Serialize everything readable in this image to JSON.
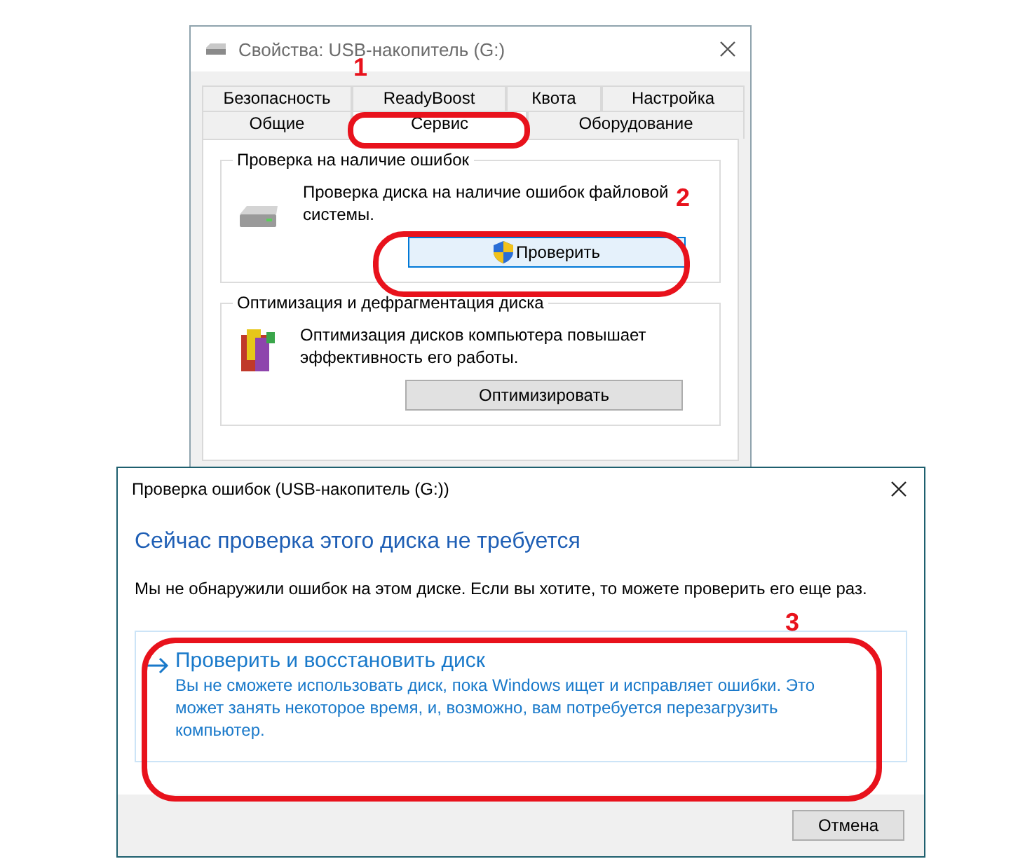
{
  "properties_window": {
    "title": "Свойства: USB-накопитель (G:)",
    "tabs_back": [
      {
        "label": "Безопасность",
        "selected": false
      },
      {
        "label": "ReadyBoost",
        "selected": false
      },
      {
        "label": "Квота",
        "selected": false
      },
      {
        "label": "Настройка",
        "selected": false
      }
    ],
    "tabs_front": [
      {
        "label": "Общие",
        "selected": false
      },
      {
        "label": "Сервис",
        "selected": true
      },
      {
        "label": "Оборудование",
        "selected": false
      }
    ],
    "groups": [
      {
        "title": "Проверка на наличие ошибок",
        "kind": "drive",
        "text": "Проверка диска на наличие ошибок файловой системы.",
        "button": "Проверить",
        "shield": true
      },
      {
        "title": "Оптимизация и дефрагментация диска",
        "kind": "defrag",
        "text": "Оптимизация дисков компьютера повышает эффективность его работы.",
        "button": "Оптимизировать",
        "shield": false
      }
    ]
  },
  "check_dialog": {
    "title": "Проверка ошибок (USB-накопитель (G:))",
    "heading": "Сейчас проверка этого диска не требуется",
    "message": "Мы не обнаружили ошибок на этом диске. Если вы хотите, то можете проверить его еще раз.",
    "command": {
      "title": "Проверить и восстановить диск",
      "description": "Вы не сможете использовать диск, пока Windows ищет и исправляет ошибки. Это может занять некоторое время, и, возможно, вам потребуется перезагрузить компьютер."
    },
    "buttons": [
      "Отмена"
    ]
  },
  "annotations": [
    {
      "number": "1"
    },
    {
      "number": "2"
    },
    {
      "number": "3"
    }
  ]
}
